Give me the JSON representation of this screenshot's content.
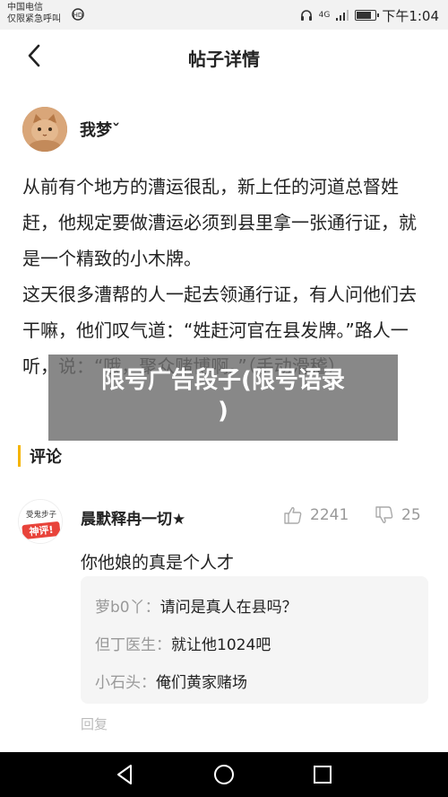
{
  "status_bar": {
    "carrier_line1": "中国电信",
    "carrier_line2": "仅限紧急呼叫",
    "carrier_extra": "HD",
    "network": "4G",
    "time": "下午1:04"
  },
  "header": {
    "title": "帖子详情",
    "back_icon": "chevron-left-icon"
  },
  "post": {
    "author_name": "我梦ˇ",
    "paragraphs": [
      "从前有个地方的漕运很乱，新上任的河道总督姓赶，他规定要做漕运必须到县里拿一张通行证，就是一个精致的小木牌。",
      "这天很多漕帮的人一起去领通行证，有人问他们去干嘛，他们叹气道：“姓赶河官在县发牌。”路人一听，说：“哦，聚众赌博啊。”（手动滑稽）"
    ]
  },
  "overlay": {
    "line1": "限号广告段子(限号语录",
    "line2": ")"
  },
  "comments": {
    "title": "评论",
    "accent_color": "#f5b400",
    "items": [
      {
        "user": "晨默释冉一切★",
        "likes": "2241",
        "dislikes": "25",
        "text": "你他娘的真是个人才",
        "avatar_text_top": "受鬼步子",
        "avatar_text_bottom": "神评!",
        "replies": [
          {
            "user": "萝b0丫：",
            "text": "请问是真人在县吗？"
          },
          {
            "user": "但丁医生：",
            "text": "就让他1024吧"
          },
          {
            "user": "小石头：",
            "text": "俺们黄家赌场"
          }
        ],
        "reply_label": "回复"
      }
    ]
  }
}
